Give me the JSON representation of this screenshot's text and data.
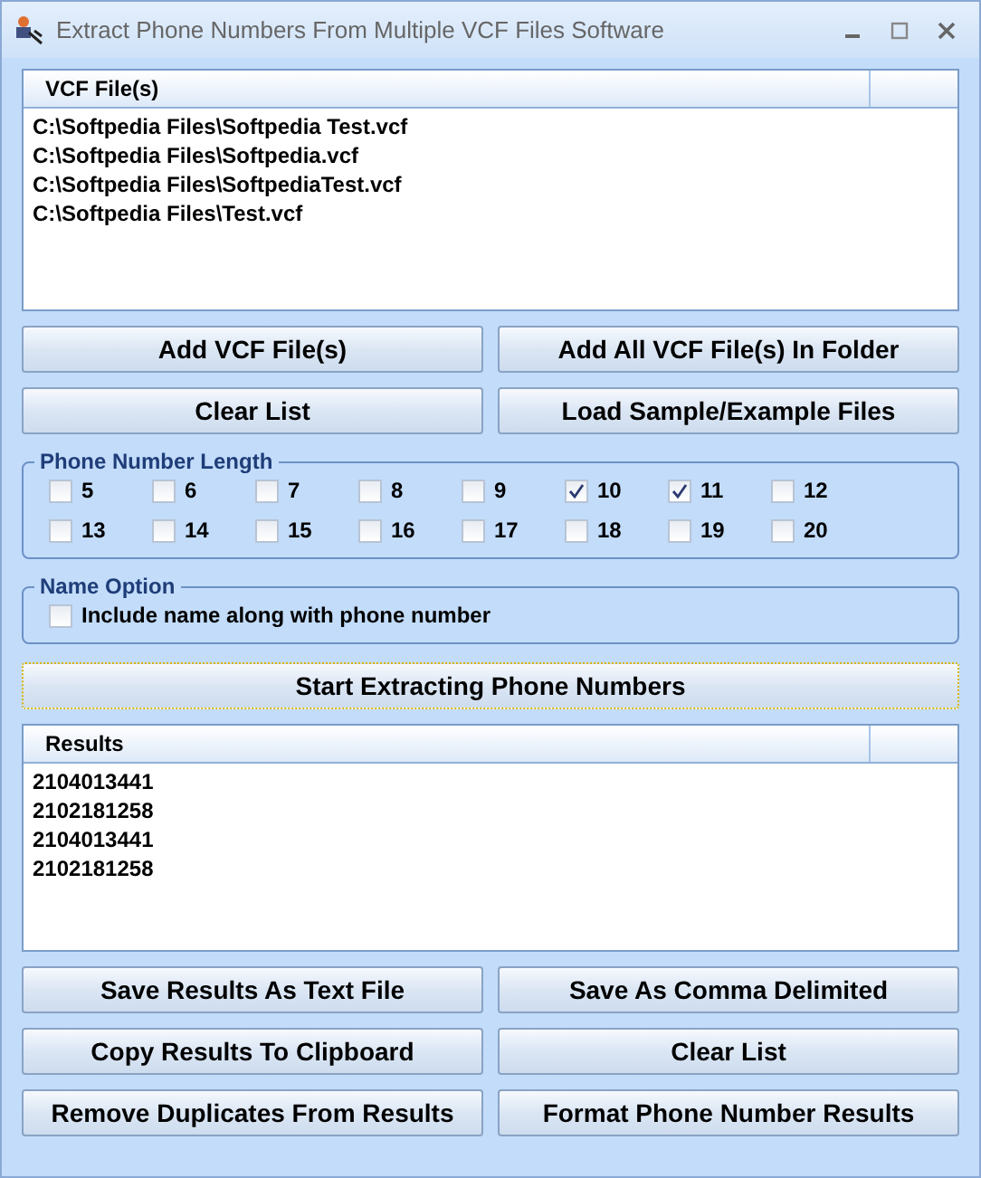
{
  "window": {
    "title": "Extract Phone Numbers From Multiple VCF Files Software"
  },
  "files_list": {
    "column": "VCF File(s)",
    "rows": [
      "C:\\Softpedia Files\\Softpedia Test.vcf",
      "C:\\Softpedia Files\\Softpedia.vcf",
      "C:\\Softpedia Files\\SoftpediaTest.vcf",
      "C:\\Softpedia Files\\Test.vcf"
    ]
  },
  "file_buttons": [
    "Add VCF File(s)",
    "Add All VCF File(s) In Folder",
    "Clear List",
    "Load Sample/Example Files"
  ],
  "phone_number_length": {
    "title": "Phone Number Length",
    "options": [
      {
        "label": "5",
        "checked": false
      },
      {
        "label": "6",
        "checked": false
      },
      {
        "label": "7",
        "checked": false
      },
      {
        "label": "8",
        "checked": false
      },
      {
        "label": "9",
        "checked": false
      },
      {
        "label": "10",
        "checked": true
      },
      {
        "label": "11",
        "checked": true
      },
      {
        "label": "12",
        "checked": false
      },
      {
        "label": "13",
        "checked": false
      },
      {
        "label": "14",
        "checked": false
      },
      {
        "label": "15",
        "checked": false
      },
      {
        "label": "16",
        "checked": false
      },
      {
        "label": "17",
        "checked": false
      },
      {
        "label": "18",
        "checked": false
      },
      {
        "label": "19",
        "checked": false
      },
      {
        "label": "20",
        "checked": false
      }
    ]
  },
  "name_option": {
    "title": "Name Option",
    "options": [
      {
        "label": "Include name along with phone number",
        "checked": false
      }
    ]
  },
  "start_button": "Start Extracting Phone Numbers",
  "results_list": {
    "column": "Results",
    "rows": [
      "2104013441",
      "2102181258",
      "2104013441",
      "2102181258"
    ]
  },
  "result_buttons": [
    "Save Results As Text File",
    "Save As Comma Delimited",
    "Copy Results To Clipboard",
    "Clear List",
    "Remove Duplicates From Results",
    "Format Phone Number Results"
  ]
}
